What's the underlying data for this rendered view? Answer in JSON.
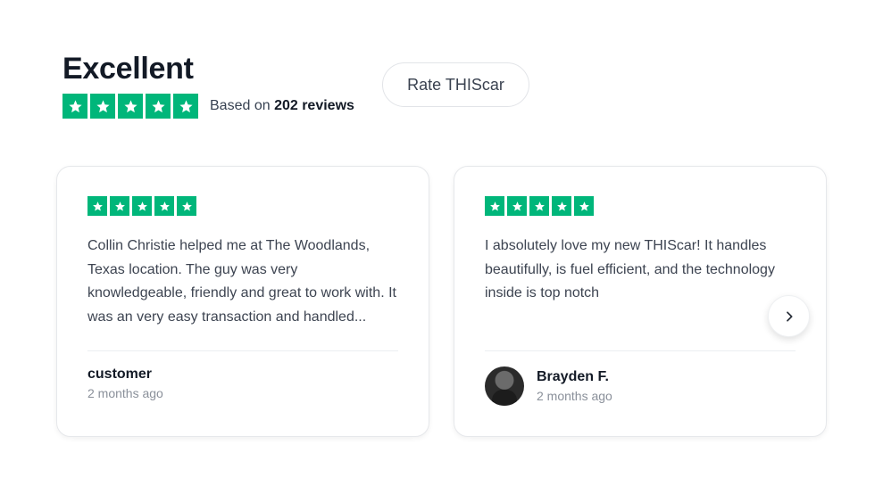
{
  "summary": {
    "rating_word": "Excellent",
    "stars": 5,
    "based_prefix": "Based on",
    "review_count": "202 reviews"
  },
  "rate_button": {
    "label": "Rate THIScar"
  },
  "reviews": [
    {
      "stars": 5,
      "text": "Collin Christie helped me at The Woodlands, Texas location. The guy was very knowledgeable, friendly and great to work with. It was an very easy transaction and handled...",
      "author": "customer",
      "time": "2 months ago",
      "has_avatar": false
    },
    {
      "stars": 5,
      "text": "I absolutely love my new THIScar! It handles beautifully, is fuel efficient, and the technology inside is top notch",
      "author": "Brayden F.",
      "time": "2 months ago",
      "has_avatar": true
    }
  ],
  "colors": {
    "star_green": "#00b67a",
    "heading": "#131a26"
  },
  "icons": {
    "star": "star-icon",
    "next": "chevron-right-icon",
    "avatar": "avatar"
  }
}
